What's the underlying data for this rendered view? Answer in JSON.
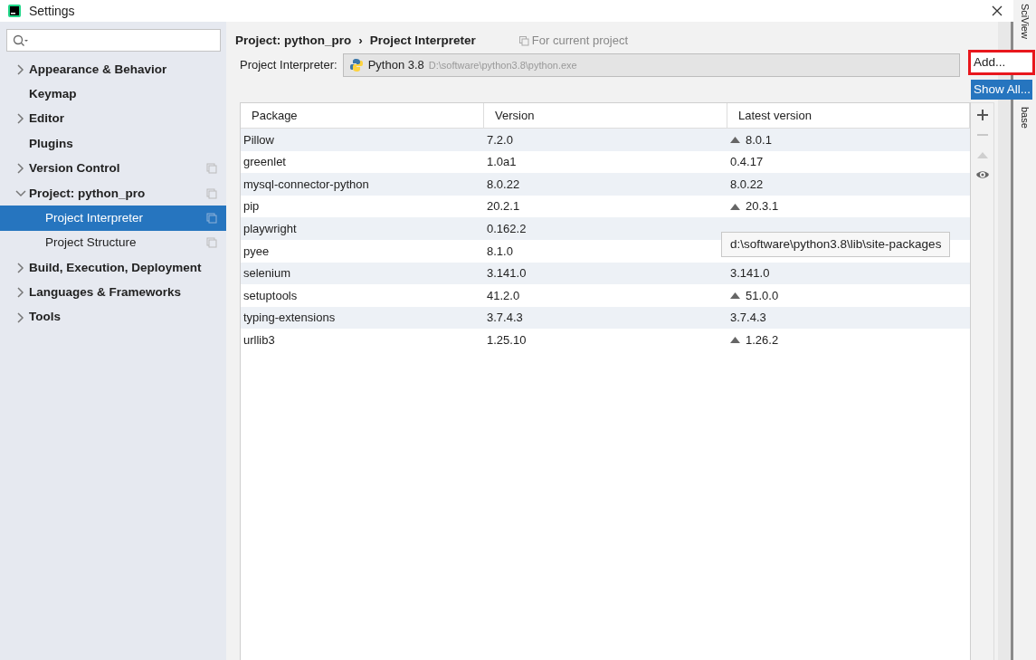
{
  "window": {
    "title": "Settings"
  },
  "sidebar": {
    "items": [
      {
        "label": "Appearance & Behavior",
        "expandable": true,
        "expanded": false,
        "project_scope": false,
        "selected": false
      },
      {
        "label": "Keymap",
        "expandable": false,
        "expanded": false,
        "project_scope": false,
        "selected": false
      },
      {
        "label": "Editor",
        "expandable": true,
        "expanded": false,
        "project_scope": false,
        "selected": false
      },
      {
        "label": "Plugins",
        "expandable": false,
        "expanded": false,
        "project_scope": false,
        "selected": false
      },
      {
        "label": "Version Control",
        "expandable": true,
        "expanded": false,
        "project_scope": true,
        "selected": false
      },
      {
        "label": "Project: python_pro",
        "expandable": true,
        "expanded": true,
        "project_scope": true,
        "selected": false,
        "children": [
          {
            "label": "Project Interpreter",
            "expandable": false,
            "expanded": false,
            "project_scope": true,
            "selected": true
          },
          {
            "label": "Project Structure",
            "expandable": false,
            "expanded": false,
            "project_scope": true,
            "selected": false
          }
        ]
      },
      {
        "label": "Build, Execution, Deployment",
        "expandable": true,
        "expanded": false,
        "project_scope": false,
        "selected": false
      },
      {
        "label": "Languages & Frameworks",
        "expandable": true,
        "expanded": false,
        "project_scope": false,
        "selected": false
      },
      {
        "label": "Tools",
        "expandable": true,
        "expanded": false,
        "project_scope": false,
        "selected": false
      }
    ]
  },
  "breadcrumb": [
    "Project: python_pro",
    "›",
    "Project Interpreter"
  ],
  "scope_note": "For current project",
  "interpreter": {
    "label": "Project Interpreter:",
    "name": "Python 3.8",
    "path": "D:\\software\\python3.8\\python.exe"
  },
  "dropdown_menu": [
    {
      "label": "Add...",
      "selected": false,
      "highlighted_frame": true
    },
    {
      "label": "Show All...",
      "selected": true,
      "highlighted_frame": false
    }
  ],
  "table": {
    "columns": [
      "Package",
      "Version",
      "Latest version"
    ],
    "rows": [
      {
        "package": "Pillow",
        "version": "7.2.0",
        "latest": "8.0.1",
        "upgrade": true
      },
      {
        "package": "greenlet",
        "version": "1.0a1",
        "latest": "0.4.17",
        "upgrade": false
      },
      {
        "package": "mysql-connector-python",
        "version": "8.0.22",
        "latest": "8.0.22",
        "upgrade": false
      },
      {
        "package": "pip",
        "version": "20.2.1",
        "latest": "20.3.1",
        "upgrade": true
      },
      {
        "package": "playwright",
        "version": "0.162.2"
      },
      {
        "package": "pyee",
        "version": "8.1.0"
      },
      {
        "package": "selenium",
        "version": "3.141.0",
        "latest": "3.141.0",
        "upgrade": false
      },
      {
        "package": "setuptools",
        "version": "41.2.0",
        "latest": "51.0.0",
        "upgrade": true
      },
      {
        "package": "typing-extensions",
        "version": "3.7.4.3",
        "latest": "3.7.4.3",
        "upgrade": false
      },
      {
        "package": "urllib3",
        "version": "1.25.10",
        "latest": "1.26.2",
        "upgrade": true
      }
    ]
  },
  "tooltip": "d:\\software\\python3.8\\lib\\site-packages",
  "side_tabs": [
    "SciView",
    "base"
  ]
}
